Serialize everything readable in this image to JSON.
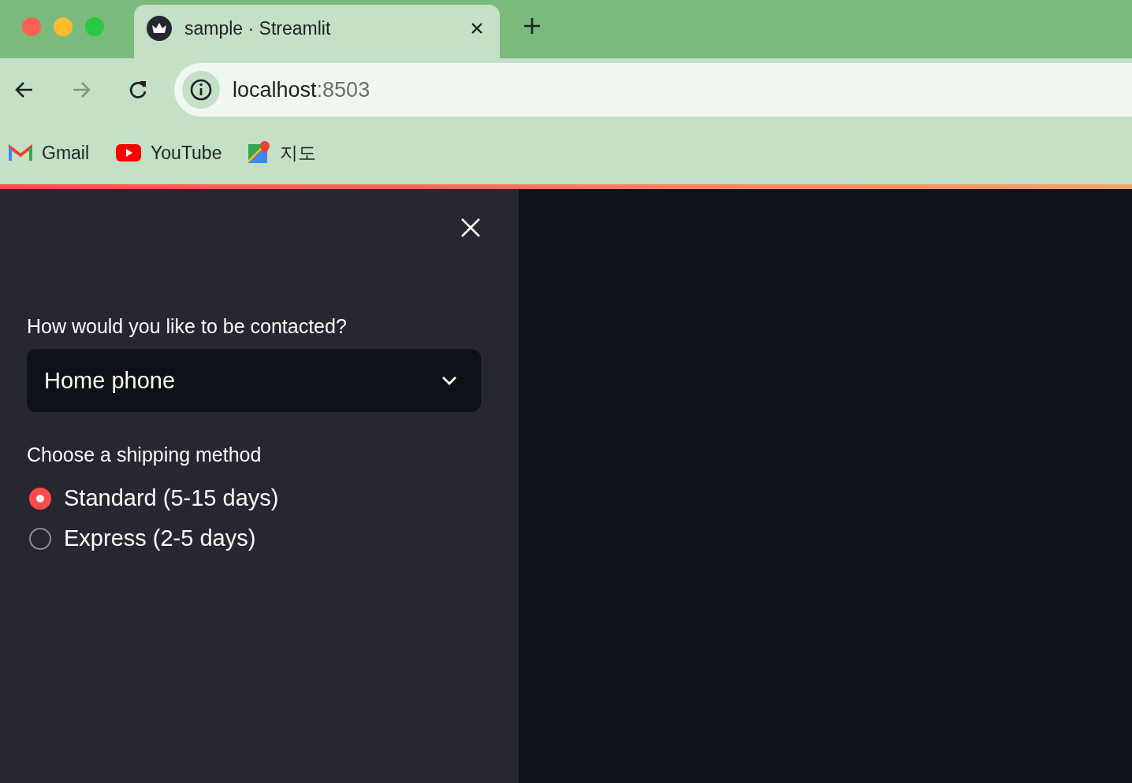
{
  "browser": {
    "tabs": [
      {
        "title": "sample · Streamlit",
        "selected": true
      }
    ],
    "address": {
      "host": "localhost",
      "port": ":8503"
    },
    "nav": {
      "back_disabled": false,
      "forward_disabled": true
    },
    "bookmarks": [
      {
        "label": "Gmail",
        "kind": "mail"
      },
      {
        "label": "YouTube",
        "kind": "video"
      },
      {
        "label": "지도",
        "kind": "map"
      }
    ]
  },
  "sidebar": {
    "select": {
      "label": "How would you like to be contacted?",
      "value": "Home phone"
    },
    "radio": {
      "label": "Choose a shipping method",
      "options": [
        {
          "label": "Standard (5-15 days)",
          "selected": true
        },
        {
          "label": "Express (2-5 days)",
          "selected": false
        }
      ]
    }
  }
}
